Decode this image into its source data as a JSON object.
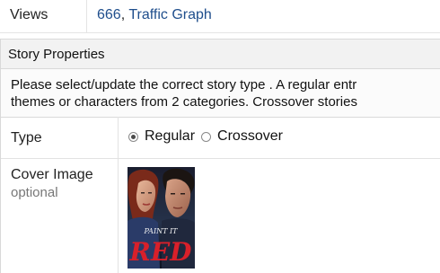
{
  "views": {
    "label": "Views",
    "count": "666",
    "separator": ",",
    "link": "Traffic Graph"
  },
  "story_properties": {
    "title": "Story Properties",
    "notice_line1": "Please select/update the correct story type . A regular entr",
    "notice_line2": "themes or characters from 2 categories. Crossover stories",
    "type": {
      "label": "Type",
      "options": [
        {
          "label": "Regular",
          "checked": true
        },
        {
          "label": "Crossover",
          "checked": false
        }
      ]
    },
    "cover": {
      "label": "Cover Image",
      "sublabel": "optional",
      "image_text_top": "PAINT IT",
      "image_text_big": "RED"
    }
  },
  "colors": {
    "link": "#1f4e8c",
    "header_bg": "#f2f2f2",
    "cover_red": "#d8202a"
  }
}
